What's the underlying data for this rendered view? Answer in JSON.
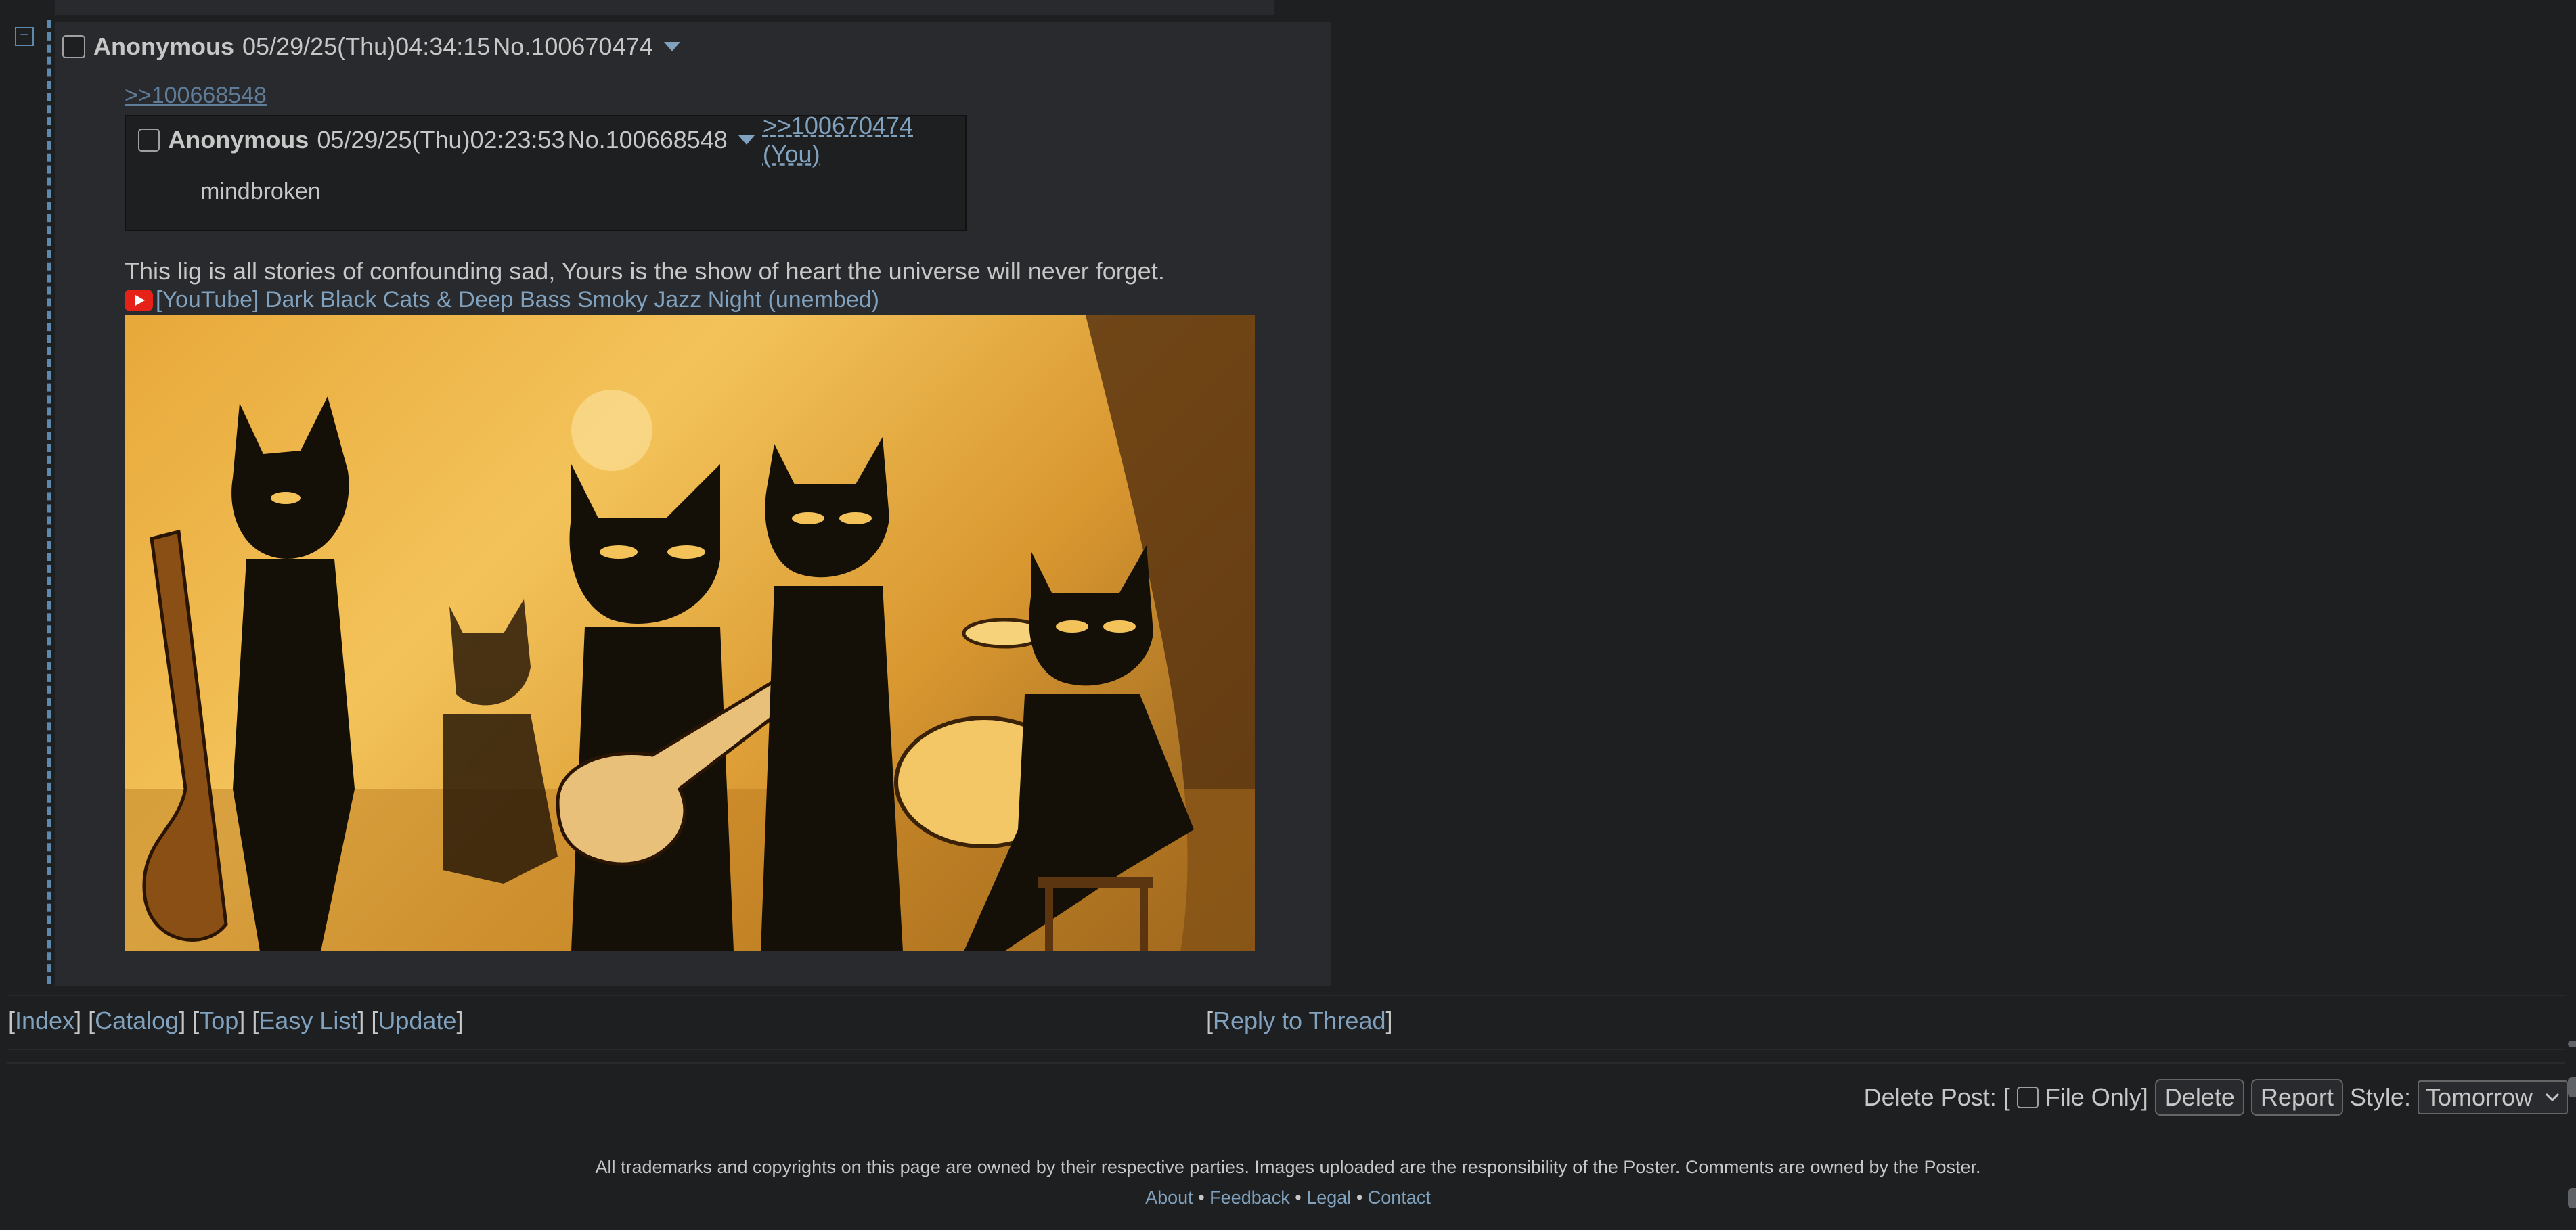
{
  "collapse_symbol": "−",
  "post": {
    "name": "Anonymous",
    "date": "05/29/25(Thu)04:34:15",
    "number": "No.100670474",
    "backlink": ">>100668548",
    "quoted_post": {
      "name": "Anonymous",
      "date": "05/29/25(Thu)02:23:53",
      "number": "No.100668548",
      "reply_link": ">>100670474 (You)",
      "text": "mindbroken"
    },
    "comment": "This lig is all stories of confounding sad, Yours is the show of heart the universe will never forget.",
    "embed_link": "[YouTube] Dark Black Cats & Deep Bass Smoky Jazz Night (unembed)"
  },
  "nav": {
    "index": "Index",
    "catalog": "Catalog",
    "top": "Top",
    "easy_list": "Easy List",
    "update": "Update",
    "reply_to_thread": "Reply to Thread"
  },
  "delete_bar": {
    "label": "Delete Post: [",
    "file_only": "File Only]",
    "delete": "Delete",
    "report": "Report",
    "style_label": "Style:",
    "style_value": "Tomorrow"
  },
  "footer": {
    "disclaimer": "All trademarks and copyrights on this page are owned by their respective parties. Images uploaded are the responsibility of the Poster. Comments are owned by the Poster.",
    "about": "About",
    "feedback": "Feedback",
    "legal": "Legal",
    "contact": "Contact",
    "separator": "•"
  },
  "colors": {
    "background": "#1d1f21",
    "post_bg": "#282a2e",
    "link": "#81a2be",
    "text": "#c5c8c6"
  }
}
